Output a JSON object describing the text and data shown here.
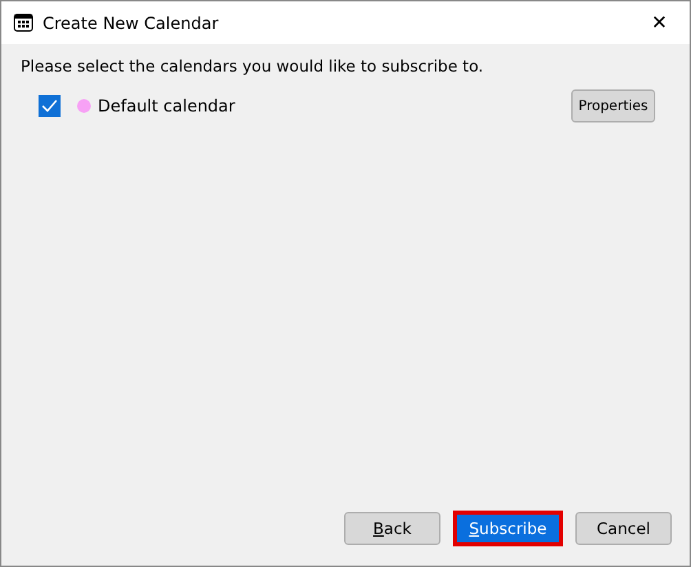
{
  "window": {
    "title": "Create New Calendar",
    "close": "✕"
  },
  "prompt": "Please select the calendars you would like to subscribe to.",
  "calendars": [
    {
      "name": "Default calendar",
      "checked": true,
      "color": "#f7a1f5"
    }
  ],
  "properties_button": "Properties",
  "buttons": [
    {
      "label": "Back",
      "kind": "normal",
      "first_letter_underlined": true,
      "highlighted": false
    },
    {
      "label": "Subscribe",
      "kind": "default",
      "first_letter_underlined": true,
      "highlighted": true
    },
    {
      "label": "Cancel",
      "kind": "normal",
      "first_letter_underlined": false,
      "highlighted": false
    }
  ]
}
